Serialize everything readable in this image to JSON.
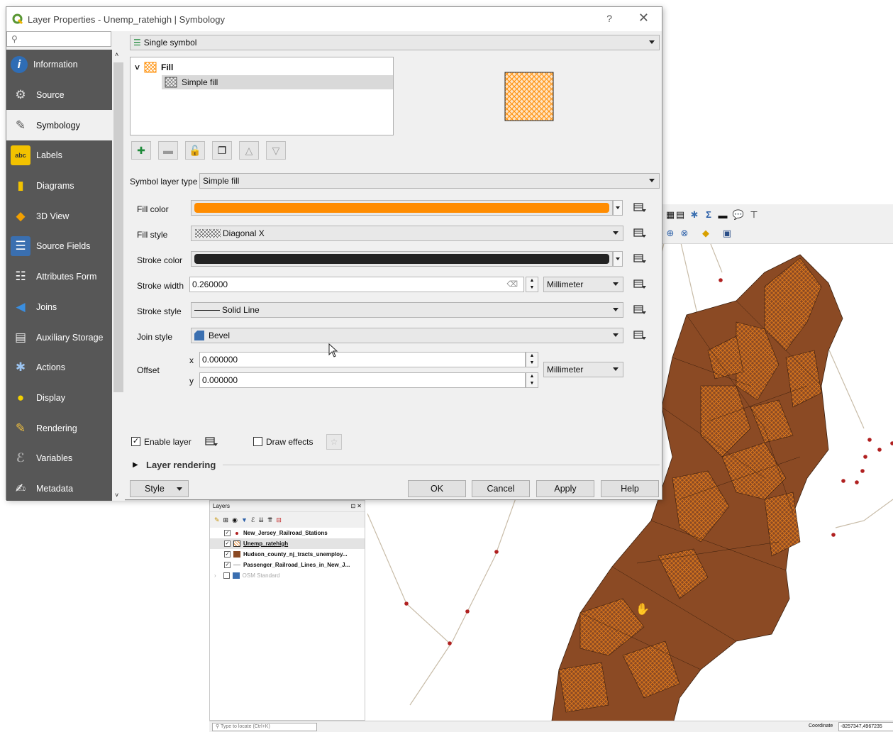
{
  "dialog": {
    "title": "Layer Properties - Unemp_ratehigh | Symbology",
    "help": "?",
    "close": "✕",
    "search_placeholder": ""
  },
  "nav": {
    "items": [
      {
        "label": "Information",
        "icon": "info-icon"
      },
      {
        "label": "Source",
        "icon": "wrench-icon"
      },
      {
        "label": "Symbology",
        "icon": "brush-icon"
      },
      {
        "label": "Labels",
        "icon": "labels-icon"
      },
      {
        "label": "Diagrams",
        "icon": "diagram-icon"
      },
      {
        "label": "3D View",
        "icon": "cube-icon"
      },
      {
        "label": "Source Fields",
        "icon": "fields-icon"
      },
      {
        "label": "Attributes Form",
        "icon": "form-icon"
      },
      {
        "label": "Joins",
        "icon": "joins-icon"
      },
      {
        "label": "Auxiliary Storage",
        "icon": "storage-icon"
      },
      {
        "label": "Actions",
        "icon": "gear-icon"
      },
      {
        "label": "Display",
        "icon": "speech-bubble-icon"
      },
      {
        "label": "Rendering",
        "icon": "paintbrush-icon"
      },
      {
        "label": "Variables",
        "icon": "epsilon-icon"
      },
      {
        "label": "Metadata",
        "icon": "metadata-icon"
      }
    ],
    "active_index": 2
  },
  "renderer": {
    "value": "Single symbol"
  },
  "tree": {
    "fill_label": "Fill",
    "simple_fill_label": "Simple fill"
  },
  "symbol_layer_type": {
    "label": "Symbol layer type",
    "value": "Simple fill"
  },
  "props": {
    "fill_color_label": "Fill color",
    "fill_color": "#ff8c00",
    "fill_style_label": "Fill style",
    "fill_style": "Diagonal X",
    "stroke_color_label": "Stroke color",
    "stroke_color": "#232323",
    "stroke_width_label": "Stroke width",
    "stroke_width": "0.260000",
    "stroke_width_unit": "Millimeter",
    "stroke_style_label": "Stroke style",
    "stroke_style": "Solid Line",
    "join_style_label": "Join style",
    "join_style": "Bevel",
    "offset_label": "Offset",
    "offset_x_label": "x",
    "offset_x": "0.000000",
    "offset_y_label": "y",
    "offset_y": "0.000000",
    "offset_unit": "Millimeter"
  },
  "enable_layer": {
    "label": "Enable layer",
    "checked": true
  },
  "draw_effects": {
    "label": "Draw effects",
    "checked": false
  },
  "layer_rendering": {
    "label": "Layer rendering"
  },
  "buttons": {
    "style": "Style",
    "ok": "OK",
    "cancel": "Cancel",
    "apply": "Apply",
    "help": "Help"
  },
  "layers_panel": {
    "title": "Layers",
    "layers": [
      {
        "name": "New_Jersey_Railroad_Stations",
        "checked": true,
        "symbol": "point"
      },
      {
        "name": "Unemp_ratehigh",
        "checked": true,
        "symbol": "hatch"
      },
      {
        "name": "Hudson_county_nj_tracts_unemploy...",
        "checked": true,
        "symbol": "solid"
      },
      {
        "name": "Passenger_Railroad_Lines_in_New_J...",
        "checked": true,
        "symbol": "line"
      },
      {
        "name": "OSM Standard",
        "checked": false,
        "symbol": "tiles"
      }
    ]
  },
  "statusbar": {
    "locate_placeholder": "Type to locate (Ctrl+K)",
    "coordinate_label": "Coordinate",
    "coordinate_value": "-8257347,4967235"
  },
  "colors": {
    "tract_fill": "#8b4a24",
    "hatch_stroke": "#e07a1c",
    "tract_outline": "#3a1e0c",
    "station": "#b02020",
    "railroad": "#c8bca8",
    "nav_bg": "#575757"
  }
}
